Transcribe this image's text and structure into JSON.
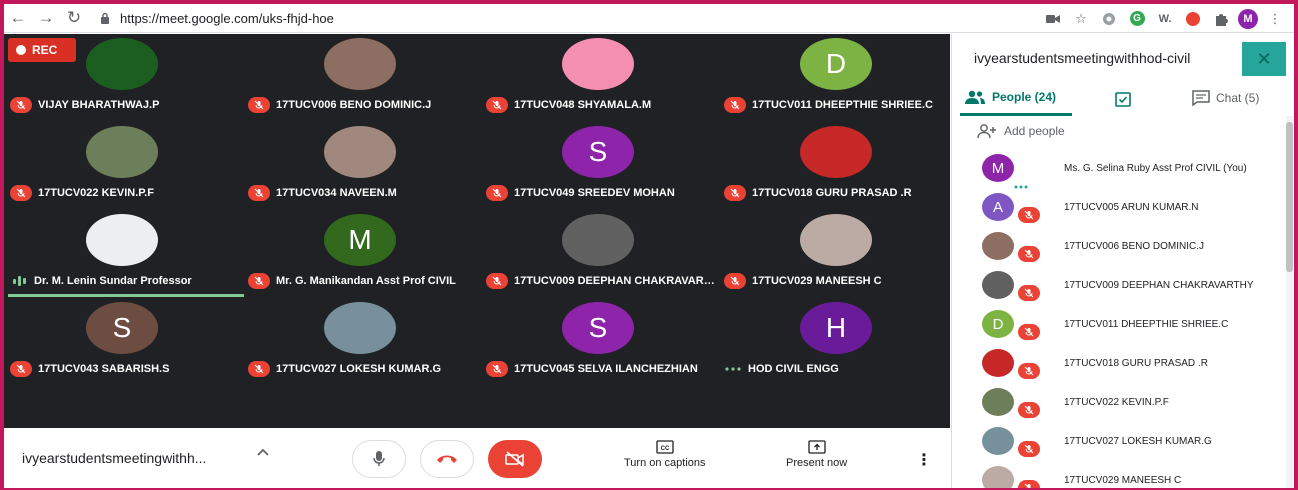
{
  "browser": {
    "url": "https://meet.google.com/uks-fhjd-hoe",
    "profile_initial": "M",
    "ext_w": "W."
  },
  "rec_label": "REC",
  "tiles": [
    {
      "name": "VIJAY BHARATHWAJ.P",
      "muted": true,
      "avatar_color": "#1b5e20",
      "initial": ""
    },
    {
      "name": "17TUCV006 BENO DOMINIC.J",
      "muted": true,
      "avatar_color": "#8d6e63",
      "initial": ""
    },
    {
      "name": "17TUCV048 SHYAMALA.M",
      "muted": true,
      "avatar_color": "#f48fb1",
      "initial": ""
    },
    {
      "name": "17TUCV011 DHEEPTHIE SHRIEE.C",
      "muted": true,
      "avatar_color": "#7cb342",
      "initial": "D"
    },
    {
      "name": "17TUCV022 KEVIN.P.F",
      "muted": true,
      "avatar_color": "#6d7f5a",
      "initial": ""
    },
    {
      "name": "17TUCV034 NAVEEN.M",
      "muted": true,
      "avatar_color": "#a1887f",
      "initial": ""
    },
    {
      "name": "17TUCV049 SREEDEV MOHAN",
      "muted": true,
      "avatar_color": "#8e24aa",
      "initial": "S"
    },
    {
      "name": "17TUCV018 GURU PRASAD .R",
      "muted": true,
      "avatar_color": "#c62828",
      "initial": ""
    },
    {
      "name": "Dr. M. Lenin Sundar Professor",
      "muted": false,
      "avatar_color": "#eceff1",
      "initial": ""
    },
    {
      "name": "Mr. G. Manikandan Asst Prof CIVIL",
      "muted": true,
      "avatar_color": "#33691e",
      "initial": "M"
    },
    {
      "name": "17TUCV009 DEEPHAN CHAKRAVARTHY",
      "muted": true,
      "avatar_color": "#616161",
      "initial": ""
    },
    {
      "name": "17TUCV029 MANEESH C",
      "muted": true,
      "avatar_color": "#bcaaa4",
      "initial": ""
    },
    {
      "name": "17TUCV043 SABARISH.S",
      "muted": true,
      "avatar_color": "#6d4c41",
      "initial": "S"
    },
    {
      "name": "17TUCV027 LOKESH KUMAR.G",
      "muted": true,
      "avatar_color": "#78909c",
      "initial": ""
    },
    {
      "name": "17TUCV045 SELVA ILANCHEZHIAN",
      "muted": true,
      "avatar_color": "#8e24aa",
      "initial": "S"
    },
    {
      "name": "HOD CIVIL ENGG",
      "muted": false,
      "avatar_color": "#6a1b9a",
      "initial": "H"
    }
  ],
  "bottombar": {
    "meeting_name": "ivyearstudentsmeetingwithh...",
    "captions_label": "Turn on captions",
    "present_label": "Present now",
    "captions_icon_text": "CC"
  },
  "panel": {
    "title": "ivyearstudentsmeetingwithhod-civil",
    "people_tab": "People (24)",
    "chat_tab": "Chat (5)",
    "add_people": "Add people",
    "people": [
      {
        "name": "Ms. G. Selina Ruby Asst Prof CIVIL (You)",
        "avatar_color": "#8e24aa",
        "initial": "M",
        "muted": false
      },
      {
        "name": "17TUCV005 ARUN KUMAR.N",
        "avatar_color": "#7e57c2",
        "initial": "A",
        "muted": true
      },
      {
        "name": "17TUCV006 BENO DOMINIC.J",
        "avatar_color": "#8d6e63",
        "initial": "",
        "muted": true
      },
      {
        "name": "17TUCV009 DEEPHAN CHAKRAVARTHY",
        "avatar_color": "#616161",
        "initial": "",
        "muted": true
      },
      {
        "name": "17TUCV011 DHEEPTHIE SHRIEE.C",
        "avatar_color": "#7cb342",
        "initial": "D",
        "muted": true
      },
      {
        "name": "17TUCV018 GURU PRASAD .R",
        "avatar_color": "#c62828",
        "initial": "",
        "muted": true
      },
      {
        "name": "17TUCV022 KEVIN.P.F",
        "avatar_color": "#6d7f5a",
        "initial": "",
        "muted": true
      },
      {
        "name": "17TUCV027 LOKESH KUMAR.G",
        "avatar_color": "#78909c",
        "initial": "",
        "muted": true
      },
      {
        "name": "17TUCV029 MANEESH C",
        "avatar_color": "#bcaaa4",
        "initial": "",
        "muted": true
      }
    ]
  },
  "colors": {
    "accent": "#00796b",
    "mute_red": "#ea4335",
    "stage_bg": "#202124"
  }
}
